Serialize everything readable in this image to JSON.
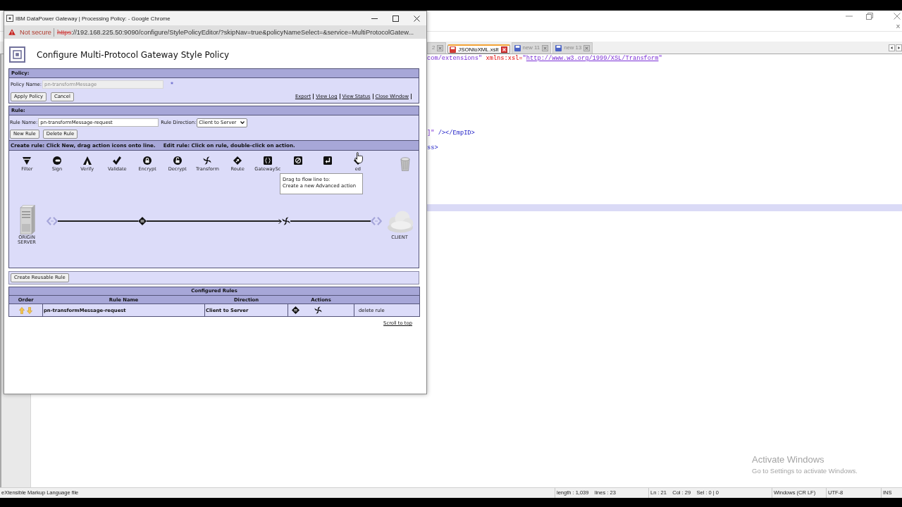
{
  "browser_popup": {
    "title": "IBM DataPower Gateway | Processing Policy: - Google Chrome",
    "security_label": "Not secure",
    "url": {
      "scheme": "https",
      "rest": "://192.168.225.50:9090/configure/StylePolicyEditor/?skipNav=true&policyNameSelect=&service=MultiProtocolGatew...",
      "secure": false
    },
    "page": {
      "title": "Configure Multi-Protocol Gateway Style Policy",
      "policy": {
        "heading": "Policy:",
        "name_label": "Policy Name:",
        "name_value": "pn-transformMessage",
        "name_disabled": true,
        "required_mark": "*",
        "buttons": [
          "Apply Policy",
          "Cancel"
        ],
        "links": [
          "Export",
          "View Log",
          "View Status",
          "Close Window"
        ]
      },
      "rule": {
        "heading": "Rule:",
        "name_label": "Rule Name:",
        "name_value": "pn-transformMessage-request",
        "direction_label": "Rule Direction:",
        "direction_value": "Client to Server",
        "buttons": [
          "New Rule",
          "Delete Rule"
        ],
        "instructions": [
          "Create rule: Click New, drag action icons onto line.",
          "Edit rule: Click on rule, double-click on action."
        ],
        "palette": [
          {
            "kind": "filter",
            "label": "Filter"
          },
          {
            "kind": "sign",
            "label": "Sign"
          },
          {
            "kind": "verify",
            "label": "Verify"
          },
          {
            "kind": "validate",
            "label": "Validate"
          },
          {
            "kind": "encrypt",
            "label": "Encrypt"
          },
          {
            "kind": "decrypt",
            "label": "Decrypt"
          },
          {
            "kind": "transform",
            "label": "Transform"
          },
          {
            "kind": "route",
            "label": "Route"
          },
          {
            "kind": "gatewayscript",
            "label": "GatewaySc"
          },
          {
            "kind": "slash-circle"
          },
          {
            "kind": "return-arrow"
          },
          {
            "kind": "advanced",
            "label": "ed"
          }
        ],
        "tooltip": "Drag to flow line to:\nCreate a new Advanced action",
        "flow": {
          "start_label": "ORIGIN SERVER",
          "end_label": "CLIENT",
          "actions": [
            {
              "kind": "match"
            },
            {
              "kind": "transform"
            }
          ]
        }
      },
      "reusable_button": "Create Reusable Rule",
      "configured_rules": {
        "caption": "Configured Rules",
        "columns": [
          "Order",
          "Rule Name",
          "Direction",
          "Actions"
        ],
        "rows": [
          {
            "name": "pn-transformMessage-request",
            "direction": "Client to Server",
            "actions": [
              {
                "kind": "match"
              },
              {
                "kind": "transform"
              }
            ],
            "delete": "delete rule"
          }
        ]
      },
      "scroll_link": "Scroll to top"
    }
  },
  "editor": {
    "menu_close": "X",
    "tabs": [
      {
        "label": "2",
        "selected": false
      },
      {
        "label": "JSONtoXML.xslt",
        "selected": true,
        "modified": true
      },
      {
        "label": "new 11",
        "selected": false,
        "modified": false
      },
      {
        "label": "new 13",
        "selected": false,
        "modified": false
      }
    ],
    "code_lines": [
      {
        "current": false,
        "tokens": [
          {
            "kind": "string",
            "text": "com/extensions\""
          },
          {
            "kind": "attribute",
            "text": " xmlns:xsl="
          },
          {
            "kind": "string",
            "text": "\""
          },
          {
            "kind": "link",
            "text": "http://www.w3.org/1999/XSL/Transform"
          },
          {
            "kind": "string",
            "text": "\""
          }
        ]
      },
      {
        "current": false
      },
      {
        "current": false
      },
      {
        "current": false
      },
      {
        "current": false
      },
      {
        "current": false
      },
      {
        "current": false
      },
      {
        "current": false
      },
      {
        "current": false
      },
      {
        "current": false
      },
      {
        "current": false,
        "tokens": [
          {
            "kind": "string",
            "text": "]\""
          },
          {
            "kind": "tag",
            "text": " /></EmpID>"
          }
        ]
      },
      {
        "current": false
      },
      {
        "current": false,
        "tokens": [
          {
            "kind": "tag",
            "text": "ss>"
          }
        ]
      },
      {
        "current": false
      },
      {
        "current": false
      },
      {
        "current": false
      },
      {
        "current": false
      },
      {
        "current": false
      },
      {
        "current": false
      },
      {
        "current": false
      },
      {
        "current": true
      }
    ],
    "status_bar": [
      "eXtensible Markup Language file",
      "length : 1,039    lines : 23",
      "Ln : 21    Col : 29    Sel : 0 | 0",
      "Windows (CR LF)",
      "UTF-8",
      "INS"
    ]
  },
  "os_notice": {
    "title": "Activate Windows",
    "text": "Go to Settings to activate Windows."
  }
}
